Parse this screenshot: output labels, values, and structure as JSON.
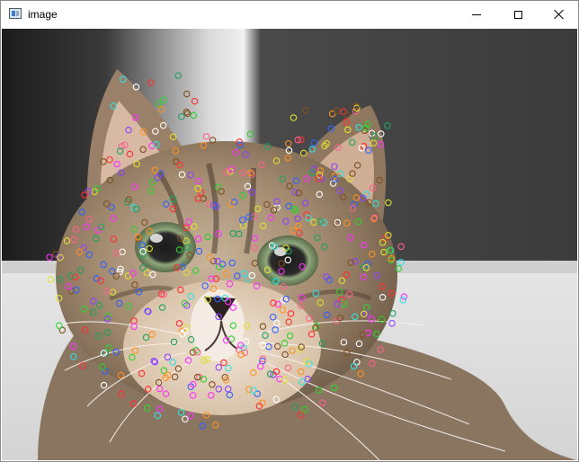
{
  "window": {
    "title": "image",
    "icons": {
      "app": "app-window-icon",
      "minimize": "minimize-icon",
      "maximize": "maximize-icon",
      "close": "close-icon"
    }
  },
  "image": {
    "subject": "cat",
    "keypoint_colors": [
      "#ff3030",
      "#30d030",
      "#3060ff",
      "#ff30ff",
      "#30e0e0",
      "#e0e030",
      "#ff9020",
      "#9040ff",
      "#ff6090",
      "#20a060",
      "#ffffff",
      "#805020"
    ]
  }
}
